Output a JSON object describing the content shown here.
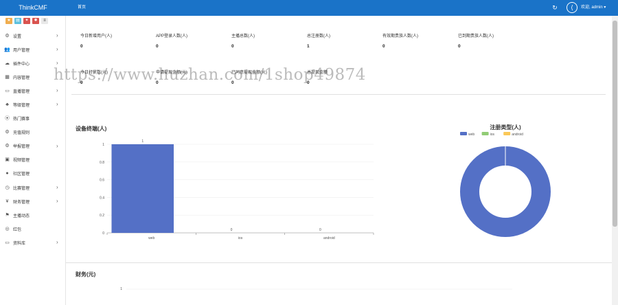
{
  "header": {
    "brand": "ThinkCMF",
    "home_tab": "首页",
    "welcome": "欢迎, admin ▾"
  },
  "colors": {
    "topbar": "#1a73c8",
    "web": "#5470c6",
    "ios": "#91cc75",
    "android": "#fac858"
  },
  "quick_buttons": [
    {
      "icon": "star-icon",
      "color": "#f0ad4e"
    },
    {
      "icon": "file-icon",
      "color": "#5bc0de"
    },
    {
      "icon": "bookmark-icon",
      "color": "#d9534f"
    },
    {
      "icon": "gear-icon",
      "color": "#d9534f"
    }
  ],
  "sidebar": {
    "items": [
      {
        "label": "设置",
        "icon": "⚙",
        "chev": "›"
      },
      {
        "label": "用户管理",
        "icon": "👥",
        "chev": "›"
      },
      {
        "label": "插件中心",
        "icon": "☁",
        "chev": "›"
      },
      {
        "label": "内容管理",
        "icon": "▦",
        "chev": ""
      },
      {
        "label": "直播管理",
        "icon": "▭",
        "chev": "›"
      },
      {
        "label": "等级管理",
        "icon": "♣",
        "chev": "›"
      },
      {
        "label": "热门赛事",
        "icon": "⦿",
        "chev": ""
      },
      {
        "label": "充值规则",
        "icon": "⚙",
        "chev": ""
      },
      {
        "label": "举报管理",
        "icon": "⚙",
        "chev": "›"
      },
      {
        "label": "视频管理",
        "icon": "▣",
        "chev": ""
      },
      {
        "label": "社区管理",
        "icon": "●",
        "chev": ""
      },
      {
        "label": "比赛管理",
        "icon": "◷",
        "chev": "›"
      },
      {
        "label": "财务管理",
        "icon": "¥",
        "chev": "›"
      },
      {
        "label": "主播动态",
        "icon": "⚑",
        "chev": ""
      },
      {
        "label": "红包",
        "icon": "◎",
        "chev": ""
      },
      {
        "label": "资料库",
        "icon": "▭",
        "chev": "›"
      }
    ]
  },
  "stats_row1": [
    {
      "label": "今日新增用户(人)",
      "value": "0"
    },
    {
      "label": "APP登录人数(人)",
      "value": "0"
    },
    {
      "label": "主播总数(人)",
      "value": "0"
    },
    {
      "label": "总注册数(人)",
      "value": "1"
    },
    {
      "label": "有效期贵族人数(人)",
      "value": "0"
    },
    {
      "label": "已到期贵族人数(人)",
      "value": "0"
    }
  ],
  "stats_row2": [
    {
      "label": "今日打赏数(元)",
      "value": "0"
    },
    {
      "label": "申请提现金额(元)",
      "value": "0"
    },
    {
      "label": "已同意提现金额(元)",
      "value": "0"
    },
    {
      "label": "总提现金额",
      "value": "0"
    }
  ],
  "watermark": "https://www.huzhan.com/1shop49874",
  "sections": {
    "device_title": "设备终端(人)",
    "finance_title": "财务(元)"
  },
  "chart_data": [
    {
      "type": "bar",
      "title": "设备终端(人)",
      "categories": [
        "web",
        "ios",
        "android"
      ],
      "values": [
        1,
        0,
        0
      ],
      "ylim": [
        0,
        1
      ],
      "yticks": [
        "0",
        "0.2",
        "0.4",
        "0.6",
        "0.8",
        "1"
      ],
      "grid": true
    },
    {
      "type": "pie",
      "title": "注册类型(人)",
      "labels": [
        "web",
        "ios",
        "android"
      ],
      "values": [
        1,
        0,
        0
      ],
      "legend": "top"
    },
    {
      "type": "line",
      "title": "财务(元)",
      "yticks": [
        "1"
      ]
    }
  ]
}
